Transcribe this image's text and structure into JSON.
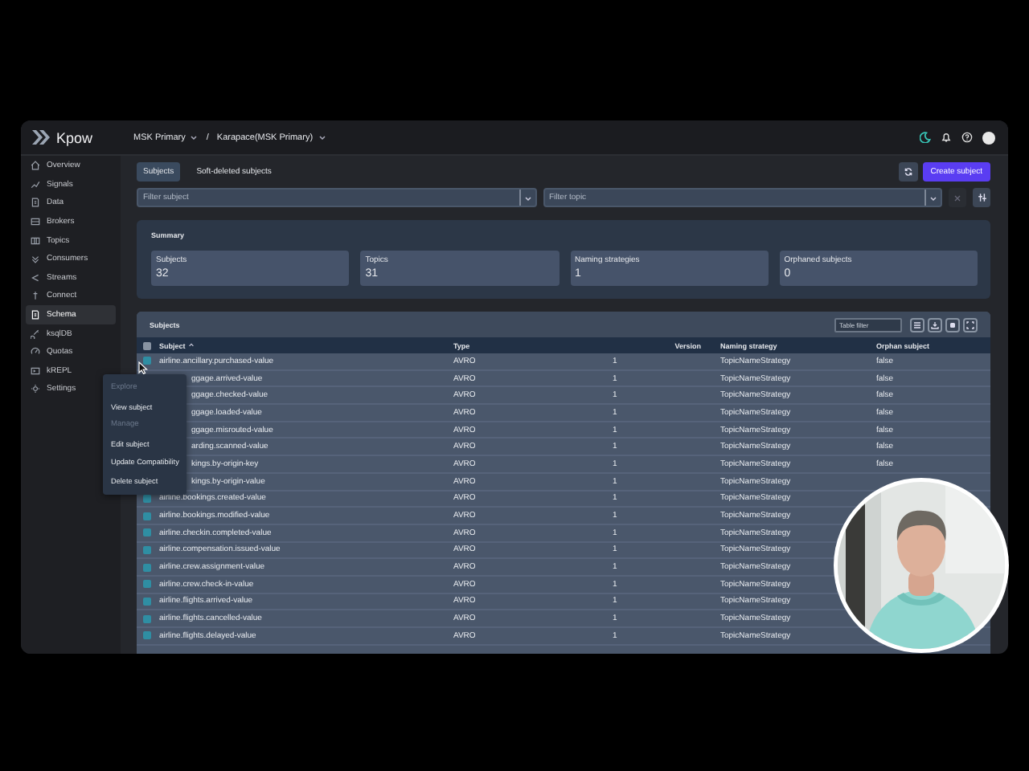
{
  "header": {
    "logo": "Kpow",
    "cluster": "MSK Primary",
    "separator": "/",
    "registry": "Karapace(MSK Primary)"
  },
  "sidebar": {
    "items": [
      {
        "label": "Overview",
        "selected": false
      },
      {
        "label": "Signals",
        "selected": false
      },
      {
        "label": "Data",
        "selected": false
      },
      {
        "label": "Brokers",
        "selected": false
      },
      {
        "label": "Topics",
        "selected": false
      },
      {
        "label": "Consumers",
        "selected": false
      },
      {
        "label": "Streams",
        "selected": false
      },
      {
        "label": "Connect",
        "selected": false
      },
      {
        "label": "Schema",
        "selected": true
      },
      {
        "label": "ksqlDB",
        "selected": false
      },
      {
        "label": "Quotas",
        "selected": false
      },
      {
        "label": "kREPL",
        "selected": false
      },
      {
        "label": "Settings",
        "selected": false
      }
    ]
  },
  "tabs": [
    {
      "label": "Subjects",
      "selected": true
    },
    {
      "label": "Soft-deleted subjects",
      "selected": false
    }
  ],
  "create_button": "Create subject",
  "filters": [
    {
      "placeholder": "Filter subject"
    },
    {
      "placeholder": "Filter topic"
    }
  ],
  "summary": {
    "title": "Summary",
    "stats": [
      {
        "label": "Subjects",
        "value": "32"
      },
      {
        "label": "Topics",
        "value": "31"
      },
      {
        "label": "Naming strategies",
        "value": "1"
      },
      {
        "label": "Orphaned subjects",
        "value": "0"
      }
    ]
  },
  "table": {
    "title": "Subjects",
    "filter_placeholder": "Table filter",
    "select_all_checked": false,
    "columns": [
      "Subject",
      "Type",
      "Version",
      "Naming strategy",
      "Orphan subject"
    ],
    "rows": [
      {
        "kind": "plain",
        "checked": false,
        "subject": "airline.ancillary.purchased-value",
        "type": "AVRO",
        "version": "1",
        "naming_strategy": "TopicNameStrategy",
        "orphan_subject": "false"
      },
      {
        "kind": "under_menu",
        "subject": "ggage.arrived-value",
        "type": "AVRO",
        "version": "1",
        "naming_strategy": "TopicNameStrategy",
        "orphan_subject": "false"
      },
      {
        "kind": "under_menu",
        "subject": "ggage.checked-value",
        "type": "AVRO",
        "version": "1",
        "naming_strategy": "TopicNameStrategy",
        "orphan_subject": "false"
      },
      {
        "kind": "under_menu",
        "subject": "ggage.loaded-value",
        "type": "AVRO",
        "version": "1",
        "naming_strategy": "TopicNameStrategy",
        "orphan_subject": "false"
      },
      {
        "kind": "under_menu",
        "subject": "ggage.misrouted-value",
        "type": "AVRO",
        "version": "1",
        "naming_strategy": "TopicNameStrategy",
        "orphan_subject": "false"
      },
      {
        "kind": "under_menu",
        "subject": "arding.scanned-value",
        "type": "AVRO",
        "version": "1",
        "naming_strategy": "TopicNameStrategy",
        "orphan_subject": "false"
      },
      {
        "kind": "under_menu",
        "subject": "kings.by-origin-key",
        "type": "AVRO",
        "version": "1",
        "naming_strategy": "TopicNameStrategy",
        "orphan_subject": "false"
      },
      {
        "kind": "under_menu",
        "subject": "kings.by-origin-value",
        "type": "AVRO",
        "version": "1",
        "naming_strategy": "TopicNameStrategy"
      },
      {
        "kind": "plain",
        "checked": false,
        "subject": "airline.bookings.created-value",
        "type": "AVRO",
        "version": "1",
        "naming_strategy": "TopicNameStrategy"
      },
      {
        "kind": "plain",
        "checked": false,
        "subject": "airline.bookings.modified-value",
        "type": "AVRO",
        "version": "1",
        "naming_strategy": "TopicNameStrategy"
      },
      {
        "kind": "plain",
        "checked": false,
        "subject": "airline.checkin.completed-value",
        "type": "AVRO",
        "version": "1",
        "naming_strategy": "TopicNameStrategy"
      },
      {
        "kind": "plain",
        "checked": false,
        "subject": "airline.compensation.issued-value",
        "type": "AVRO",
        "version": "1",
        "naming_strategy": "TopicNameStrategy"
      },
      {
        "kind": "plain",
        "checked": false,
        "subject": "airline.crew.assignment-value",
        "type": "AVRO",
        "version": "1",
        "naming_strategy": "TopicNameStrategy"
      },
      {
        "kind": "plain",
        "checked": false,
        "subject": "airline.crew.check-in-value",
        "type": "AVRO",
        "version": "1",
        "naming_strategy": "TopicNameStrategy"
      },
      {
        "kind": "plain",
        "checked": false,
        "subject": "airline.flights.arrived-value",
        "type": "AVRO",
        "version": "1",
        "naming_strategy": "TopicNameStrategy"
      },
      {
        "kind": "plain",
        "checked": false,
        "subject": "airline.flights.cancelled-value",
        "type": "AVRO",
        "version": "1",
        "naming_strategy": "TopicNameStrategy"
      },
      {
        "kind": "plain",
        "checked": false,
        "subject": "airline.flights.delayed-value",
        "type": "AVRO",
        "version": "1",
        "naming_strategy": "TopicNameStrategy"
      }
    ]
  },
  "context_menu": {
    "items": [
      {
        "kind": "group",
        "label": "Explore"
      },
      {
        "kind": "action",
        "label": "View subject"
      },
      {
        "kind": "group",
        "label": "Manage"
      },
      {
        "kind": "action",
        "label": "Edit subject"
      },
      {
        "kind": "action",
        "label": "Update Compatibility"
      },
      {
        "kind": "action",
        "label": "Delete subject"
      }
    ]
  }
}
